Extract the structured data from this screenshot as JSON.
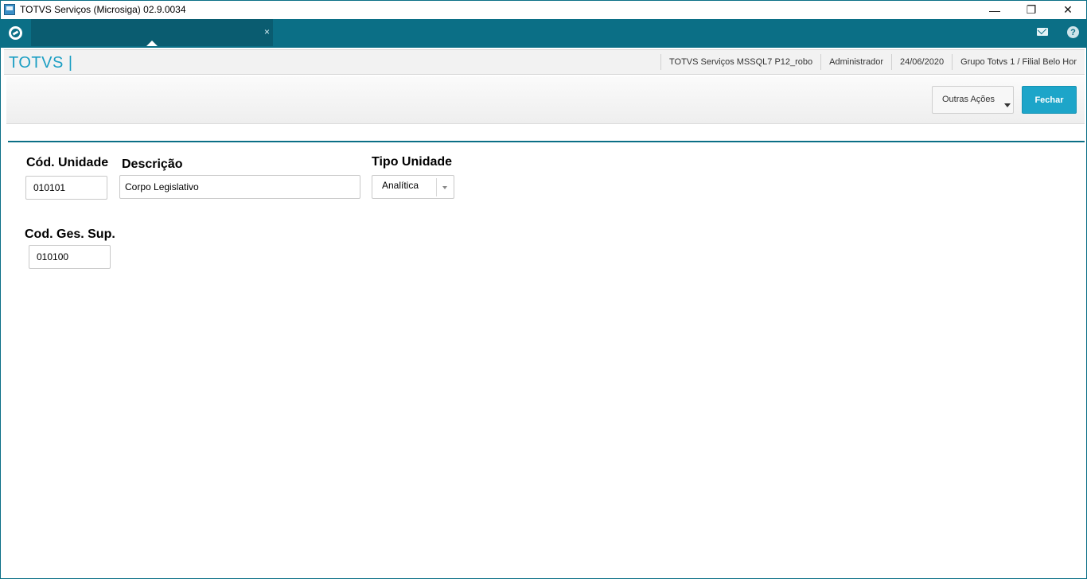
{
  "window": {
    "title": "TOTVS Serviços (Microsiga) 02.9.0034",
    "controls": {
      "minimize": "—",
      "maximize": "❐",
      "close": "✕"
    }
  },
  "topbar": {
    "tab_close": "×",
    "icons": [
      "totvs-logo-icon",
      "mail-icon",
      "help-icon"
    ],
    "help_glyph": "?"
  },
  "infobar": {
    "brand": "TOTVS |",
    "environment": "TOTVS Serviços MSSQL7 P12_robo",
    "user": "Administrador",
    "date": "24/06/2020",
    "company": "Grupo Totvs 1 / Filial Belo Hor"
  },
  "toolbar": {
    "other_actions_label": "Outras Ações",
    "close_label": "Fechar"
  },
  "form": {
    "cod_unidade": {
      "label": "Cód. Unidade",
      "value": "010101"
    },
    "descricao": {
      "label": "Descrição",
      "value": "Corpo Legislativo"
    },
    "tipo_unidade": {
      "label": "Tipo Unidade",
      "value": "Analítica"
    },
    "cod_ges_sup": {
      "label": "Cod. Ges. Sup.",
      "value": "010100"
    }
  },
  "colors": {
    "accent": "#0b6f86",
    "brand_text": "#1a9ec3",
    "primary_button": "#1da5c9"
  }
}
